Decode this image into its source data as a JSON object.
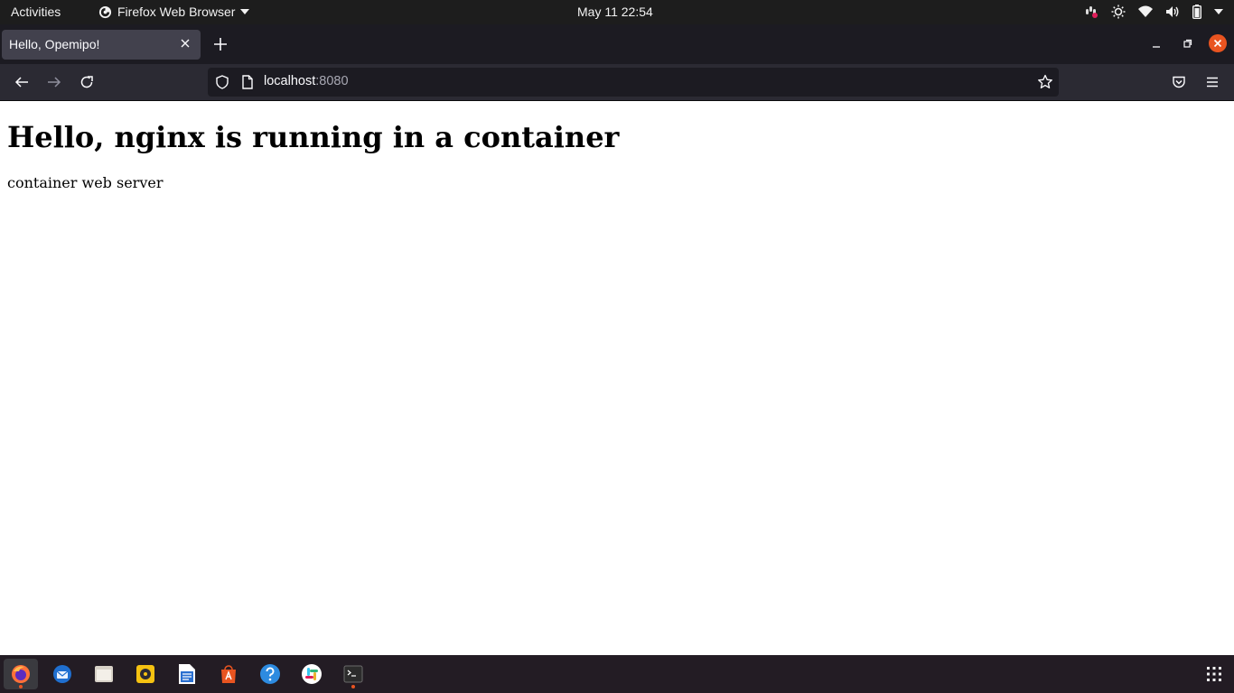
{
  "system": {
    "activities_label": "Activities",
    "app_menu_label": "Firefox Web Browser",
    "clock": "May 11  22:54"
  },
  "browser": {
    "tab_title": "Hello, Opemipo!",
    "url_host": "localhost",
    "url_port": ":8080"
  },
  "page": {
    "heading": "Hello, nginx is running in a container",
    "paragraph": "container web server"
  },
  "dock": {
    "items": [
      "firefox-icon",
      "thunderbird-icon",
      "files-icon",
      "rhythmbox-icon",
      "writer-icon",
      "software-icon",
      "help-icon",
      "slack-icon",
      "terminal-icon"
    ]
  },
  "colors": {
    "topbar": "#1d1d1d",
    "tabstrip": "#1c1b22",
    "navbar": "#2b2a33",
    "dock": "#231c24",
    "accent": "#e95420"
  }
}
